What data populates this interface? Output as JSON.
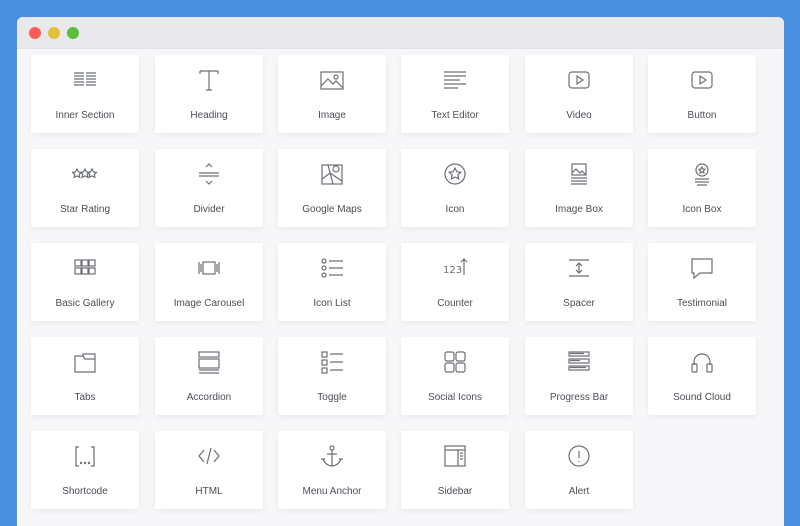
{
  "window": {
    "controls": [
      "close",
      "minimize",
      "maximize"
    ],
    "colors": {
      "frame": "#4a8fe0",
      "close": "#fc5b57",
      "minimize": "#e5bf3c",
      "maximize": "#57c038"
    }
  },
  "widgets": [
    {
      "label": "Inner Section",
      "icon": "inner-section-icon"
    },
    {
      "label": "Heading",
      "icon": "heading-icon"
    },
    {
      "label": "Image",
      "icon": "image-icon"
    },
    {
      "label": "Text Editor",
      "icon": "text-editor-icon"
    },
    {
      "label": "Video",
      "icon": "video-icon"
    },
    {
      "label": "Button",
      "icon": "button-icon"
    },
    {
      "label": "Star Rating",
      "icon": "star-rating-icon"
    },
    {
      "label": "Divider",
      "icon": "divider-icon"
    },
    {
      "label": "Google Maps",
      "icon": "google-maps-icon"
    },
    {
      "label": "Icon",
      "icon": "icon-icon"
    },
    {
      "label": "Image Box",
      "icon": "image-box-icon"
    },
    {
      "label": "Icon Box",
      "icon": "icon-box-icon"
    },
    {
      "label": "Basic Gallery",
      "icon": "basic-gallery-icon"
    },
    {
      "label": "Image Carousel",
      "icon": "image-carousel-icon"
    },
    {
      "label": "Icon List",
      "icon": "icon-list-icon"
    },
    {
      "label": "Counter",
      "icon": "counter-icon"
    },
    {
      "label": "Spacer",
      "icon": "spacer-icon"
    },
    {
      "label": "Testimonial",
      "icon": "testimonial-icon"
    },
    {
      "label": "Tabs",
      "icon": "tabs-icon"
    },
    {
      "label": "Accordion",
      "icon": "accordion-icon"
    },
    {
      "label": "Toggle",
      "icon": "toggle-icon"
    },
    {
      "label": "Social Icons",
      "icon": "social-icons-icon"
    },
    {
      "label": "Progress Bar",
      "icon": "progress-bar-icon"
    },
    {
      "label": "Sound Cloud",
      "icon": "sound-cloud-icon"
    },
    {
      "label": "Shortcode",
      "icon": "shortcode-icon"
    },
    {
      "label": "HTML",
      "icon": "html-icon"
    },
    {
      "label": "Menu Anchor",
      "icon": "menu-anchor-icon"
    },
    {
      "label": "Sidebar",
      "icon": "sidebar-icon"
    },
    {
      "label": "Alert",
      "icon": "alert-icon"
    }
  ]
}
